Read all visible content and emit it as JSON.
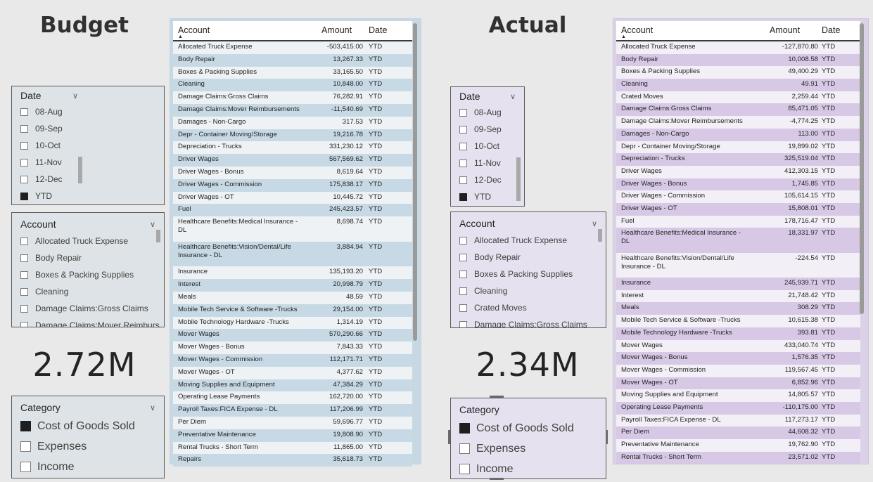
{
  "budget": {
    "heading": "Budget",
    "total": "2.72M",
    "date_slicer": {
      "title": "Date",
      "items": [
        {
          "label": "08-Aug",
          "checked": false
        },
        {
          "label": "09-Sep",
          "checked": false
        },
        {
          "label": "10-Oct",
          "checked": false
        },
        {
          "label": "11-Nov",
          "checked": false
        },
        {
          "label": "12-Dec",
          "checked": false
        },
        {
          "label": "YTD",
          "checked": true
        }
      ]
    },
    "account_slicer": {
      "title": "Account",
      "items": [
        {
          "label": "Allocated Truck Expense",
          "checked": false
        },
        {
          "label": "Body Repair",
          "checked": false
        },
        {
          "label": "Boxes & Packing Supplies",
          "checked": false
        },
        {
          "label": "Cleaning",
          "checked": false
        },
        {
          "label": "Damage Claims:Gross Claims",
          "checked": false
        },
        {
          "label": "Damage Claims:Mover Reimburs...",
          "checked": false
        }
      ]
    },
    "category_slicer": {
      "title": "Category",
      "items": [
        {
          "label": "Cost of Goods Sold",
          "checked": true
        },
        {
          "label": "Expenses",
          "checked": false
        },
        {
          "label": "Income",
          "checked": false
        }
      ]
    },
    "table": {
      "headers": {
        "account": "Account",
        "amount": "Amount",
        "date": "Date"
      },
      "rows": [
        {
          "account": "Allocated Truck Expense",
          "amount": "-503,415.00",
          "date": "YTD"
        },
        {
          "account": "Body Repair",
          "amount": "13,267.33",
          "date": "YTD"
        },
        {
          "account": "Boxes & Packing Supplies",
          "amount": "33,165.50",
          "date": "YTD"
        },
        {
          "account": "Cleaning",
          "amount": "10,848.00",
          "date": "YTD"
        },
        {
          "account": "Damage Claims:Gross Claims",
          "amount": "76,282.91",
          "date": "YTD"
        },
        {
          "account": "Damage Claims:Mover Reimbursements",
          "amount": "-11,540.69",
          "date": "YTD"
        },
        {
          "account": "Damages - Non-Cargo",
          "amount": "317.53",
          "date": "YTD"
        },
        {
          "account": "Depr - Container Moving/Storage",
          "amount": "19,216.78",
          "date": "YTD"
        },
        {
          "account": "Depreciation - Trucks",
          "amount": "331,230.12",
          "date": "YTD"
        },
        {
          "account": "Driver Wages",
          "amount": "567,569.62",
          "date": "YTD"
        },
        {
          "account": "Driver Wages - Bonus",
          "amount": "8,619.64",
          "date": "YTD"
        },
        {
          "account": "Driver Wages - Commission",
          "amount": "175,838.17",
          "date": "YTD"
        },
        {
          "account": "Driver Wages - OT",
          "amount": "10,445.72",
          "date": "YTD"
        },
        {
          "account": "Fuel",
          "amount": "245,423.57",
          "date": "YTD"
        },
        {
          "account": "Healthcare Benefits:Medical Insurance -",
          "account2": "DL",
          "amount": "8,698.74",
          "date": "YTD"
        },
        {
          "account": "Healthcare Benefits:Vision/Dental/Life",
          "account2": "Insurance - DL",
          "amount": "3,884.94",
          "date": "YTD"
        },
        {
          "account": "Insurance",
          "amount": "135,193.20",
          "date": "YTD"
        },
        {
          "account": "Interest",
          "amount": "20,998.79",
          "date": "YTD"
        },
        {
          "account": "Meals",
          "amount": "48.59",
          "date": "YTD"
        },
        {
          "account": "Mobile Tech Service & Software -Trucks",
          "amount": "29,154.00",
          "date": "YTD"
        },
        {
          "account": "Mobile Technology Hardware -Trucks",
          "amount": "1,314.19",
          "date": "YTD"
        },
        {
          "account": "Mover Wages",
          "amount": "570,290.66",
          "date": "YTD"
        },
        {
          "account": "Mover Wages - Bonus",
          "amount": "7,843.33",
          "date": "YTD"
        },
        {
          "account": "Mover Wages - Commission",
          "amount": "112,171.71",
          "date": "YTD"
        },
        {
          "account": "Mover Wages - OT",
          "amount": "4,377.62",
          "date": "YTD"
        },
        {
          "account": "Moving Supplies and Equipment",
          "amount": "47,384.29",
          "date": "YTD"
        },
        {
          "account": "Operating Lease Payments",
          "amount": "162,720.00",
          "date": "YTD"
        },
        {
          "account": "Payroll Taxes:FICA Expense - DL",
          "amount": "117,206.99",
          "date": "YTD"
        },
        {
          "account": "Per Diem",
          "amount": "59,696.77",
          "date": "YTD"
        },
        {
          "account": "Preventative Maintenance",
          "amount": "19,808.90",
          "date": "YTD"
        },
        {
          "account": "Rental Trucks - Short Term",
          "amount": "11,865.00",
          "date": "YTD"
        },
        {
          "account": "Repairs",
          "amount": "35,618.73",
          "date": "YTD"
        }
      ]
    }
  },
  "actual": {
    "heading": "Actual",
    "total": "2.34M",
    "date_slicer": {
      "title": "Date",
      "items": [
        {
          "label": "08-Aug",
          "checked": false
        },
        {
          "label": "09-Sep",
          "checked": false
        },
        {
          "label": "10-Oct",
          "checked": false
        },
        {
          "label": "11-Nov",
          "checked": false
        },
        {
          "label": "12-Dec",
          "checked": false
        },
        {
          "label": "YTD",
          "checked": true
        }
      ]
    },
    "account_slicer": {
      "title": "Account",
      "items": [
        {
          "label": "Allocated Truck Expense",
          "checked": false
        },
        {
          "label": "Body Repair",
          "checked": false
        },
        {
          "label": "Boxes & Packing Supplies",
          "checked": false
        },
        {
          "label": "Cleaning",
          "checked": false
        },
        {
          "label": "Crated Moves",
          "checked": false
        },
        {
          "label": "Damage Claims:Gross Claims",
          "checked": false
        }
      ]
    },
    "category_slicer": {
      "title": "Category",
      "items": [
        {
          "label": "Cost of Goods Sold",
          "checked": true
        },
        {
          "label": "Expenses",
          "checked": false
        },
        {
          "label": "Income",
          "checked": false
        }
      ]
    },
    "table": {
      "headers": {
        "account": "Account",
        "amount": "Amount",
        "date": "Date"
      },
      "rows": [
        {
          "account": "Allocated Truck Expense",
          "amount": "-127,870.80",
          "date": "YTD"
        },
        {
          "account": "Body Repair",
          "amount": "10,008.58",
          "date": "YTD"
        },
        {
          "account": "Boxes & Packing Supplies",
          "amount": "49,400.29",
          "date": "YTD"
        },
        {
          "account": "Cleaning",
          "amount": "49.91",
          "date": "YTD"
        },
        {
          "account": "Crated Moves",
          "amount": "2,259.44",
          "date": "YTD"
        },
        {
          "account": "Damage Claims:Gross Claims",
          "amount": "85,471.05",
          "date": "YTD"
        },
        {
          "account": "Damage Claims:Mover Reimbursements",
          "amount": "-4,774.25",
          "date": "YTD"
        },
        {
          "account": "Damages - Non-Cargo",
          "amount": "113.00",
          "date": "YTD"
        },
        {
          "account": "Depr - Container Moving/Storage",
          "amount": "19,899.02",
          "date": "YTD"
        },
        {
          "account": "Depreciation - Trucks",
          "amount": "325,519.04",
          "date": "YTD"
        },
        {
          "account": "Driver Wages",
          "amount": "412,303.15",
          "date": "YTD"
        },
        {
          "account": "Driver Wages - Bonus",
          "amount": "1,745.85",
          "date": "YTD"
        },
        {
          "account": "Driver Wages - Commission",
          "amount": "105,614.15",
          "date": "YTD"
        },
        {
          "account": "Driver Wages - OT",
          "amount": "15,808.01",
          "date": "YTD"
        },
        {
          "account": "Fuel",
          "amount": "178,716.47",
          "date": "YTD"
        },
        {
          "account": "Healthcare Benefits:Medical Insurance -",
          "account2": "DL",
          "amount": "18,331.97",
          "date": "YTD"
        },
        {
          "account": "Healthcare Benefits:Vision/Dental/Life",
          "account2": "Insurance - DL",
          "amount": "-224.54",
          "date": "YTD"
        },
        {
          "account": "Insurance",
          "amount": "245,939.71",
          "date": "YTD"
        },
        {
          "account": "Interest",
          "amount": "21,748.42",
          "date": "YTD"
        },
        {
          "account": "Meals",
          "amount": "308.29",
          "date": "YTD"
        },
        {
          "account": "Mobile Tech Service & Software -Trucks",
          "amount": "10,615.38",
          "date": "YTD"
        },
        {
          "account": "Mobile Technology Hardware -Trucks",
          "amount": "393.81",
          "date": "YTD"
        },
        {
          "account": "Mover Wages",
          "amount": "433,040.74",
          "date": "YTD"
        },
        {
          "account": "Mover Wages - Bonus",
          "amount": "1,576.35",
          "date": "YTD"
        },
        {
          "account": "Mover Wages - Commission",
          "amount": "119,567.45",
          "date": "YTD"
        },
        {
          "account": "Mover Wages - OT",
          "amount": "6,852.96",
          "date": "YTD"
        },
        {
          "account": "Moving Supplies and Equipment",
          "amount": "14,805.57",
          "date": "YTD"
        },
        {
          "account": "Operating Lease Payments",
          "amount": "-110,175.00",
          "date": "YTD"
        },
        {
          "account": "Payroll Taxes:FICA Expense - DL",
          "amount": "117,273.17",
          "date": "YTD"
        },
        {
          "account": "Per Diem",
          "amount": "44,608.32",
          "date": "YTD"
        },
        {
          "account": "Preventative Maintenance",
          "amount": "19,762.90",
          "date": "YTD"
        },
        {
          "account": "Rental Trucks - Short Term",
          "amount": "23,571.02",
          "date": "YTD"
        }
      ]
    }
  },
  "icons": {
    "chevron": "chevron-down-icon",
    "sort": "sort-ascending-icon"
  }
}
